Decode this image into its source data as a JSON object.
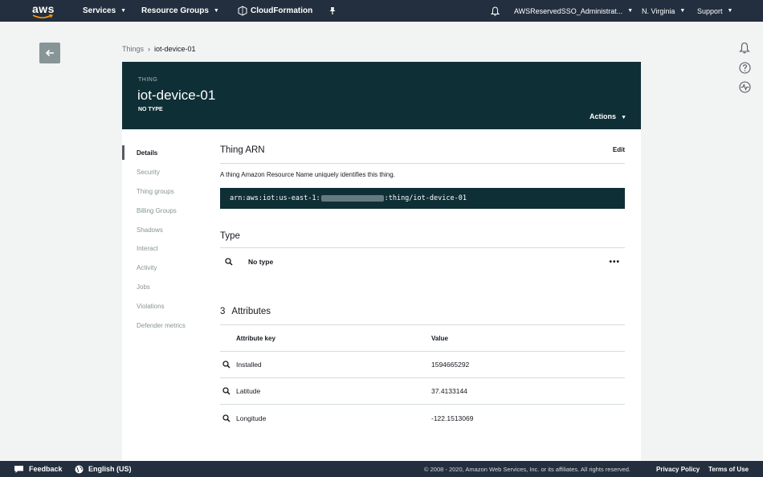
{
  "topnav": {
    "logo": "aws",
    "services": "Services",
    "resource_groups": "Resource Groups",
    "cloudformation": "CloudFormation",
    "account": "AWSReservedSSO_Administrat...",
    "region": "N. Virginia",
    "support": "Support",
    "icons": [
      "cloudformation-icon",
      "pin-icon",
      "bell-icon"
    ]
  },
  "breadcrumb": {
    "parent": "Things",
    "current": "iot-device-01"
  },
  "header": {
    "kind": "THING",
    "title": "iot-device-01",
    "type": "NO TYPE",
    "actions": "Actions"
  },
  "sidenav": {
    "items": [
      {
        "label": "Details",
        "active": true
      },
      {
        "label": "Security",
        "active": false
      },
      {
        "label": "Thing groups",
        "active": false
      },
      {
        "label": "Billing Groups",
        "active": false
      },
      {
        "label": "Shadows",
        "active": false
      },
      {
        "label": "Interact",
        "active": false
      },
      {
        "label": "Activity",
        "active": false
      },
      {
        "label": "Jobs",
        "active": false
      },
      {
        "label": "Violations",
        "active": false
      },
      {
        "label": "Defender metrics",
        "active": false
      }
    ]
  },
  "thing_arn": {
    "title": "Thing ARN",
    "edit": "Edit",
    "description": "A thing Amazon Resource Name uniquely identifies this thing.",
    "arn_prefix": "arn:aws:iot:us-east-1:",
    "arn_suffix": ":thing/iot-device-01"
  },
  "type_section": {
    "title": "Type",
    "value": "No type",
    "more": "•••"
  },
  "attributes": {
    "count": "3",
    "title": "Attributes",
    "columns": {
      "key": "Attribute key",
      "value": "Value"
    },
    "rows": [
      {
        "key": "Installed",
        "value": "1594665292"
      },
      {
        "key": "Latitude",
        "value": "37.4133144"
      },
      {
        "key": "Longitude",
        "value": "-122.1513069"
      }
    ]
  },
  "footer": {
    "feedback": "Feedback",
    "language": "English (US)",
    "copyright": "© 2008 - 2020, Amazon Web Services, Inc. or its affiliates. All rights reserved.",
    "privacy": "Privacy Policy",
    "terms": "Terms of Use"
  },
  "colors": {
    "nav_bg": "#232f3e",
    "header_bg": "#0f2f36",
    "page_bg": "#f2f3f3",
    "back_button": "#879596"
  }
}
